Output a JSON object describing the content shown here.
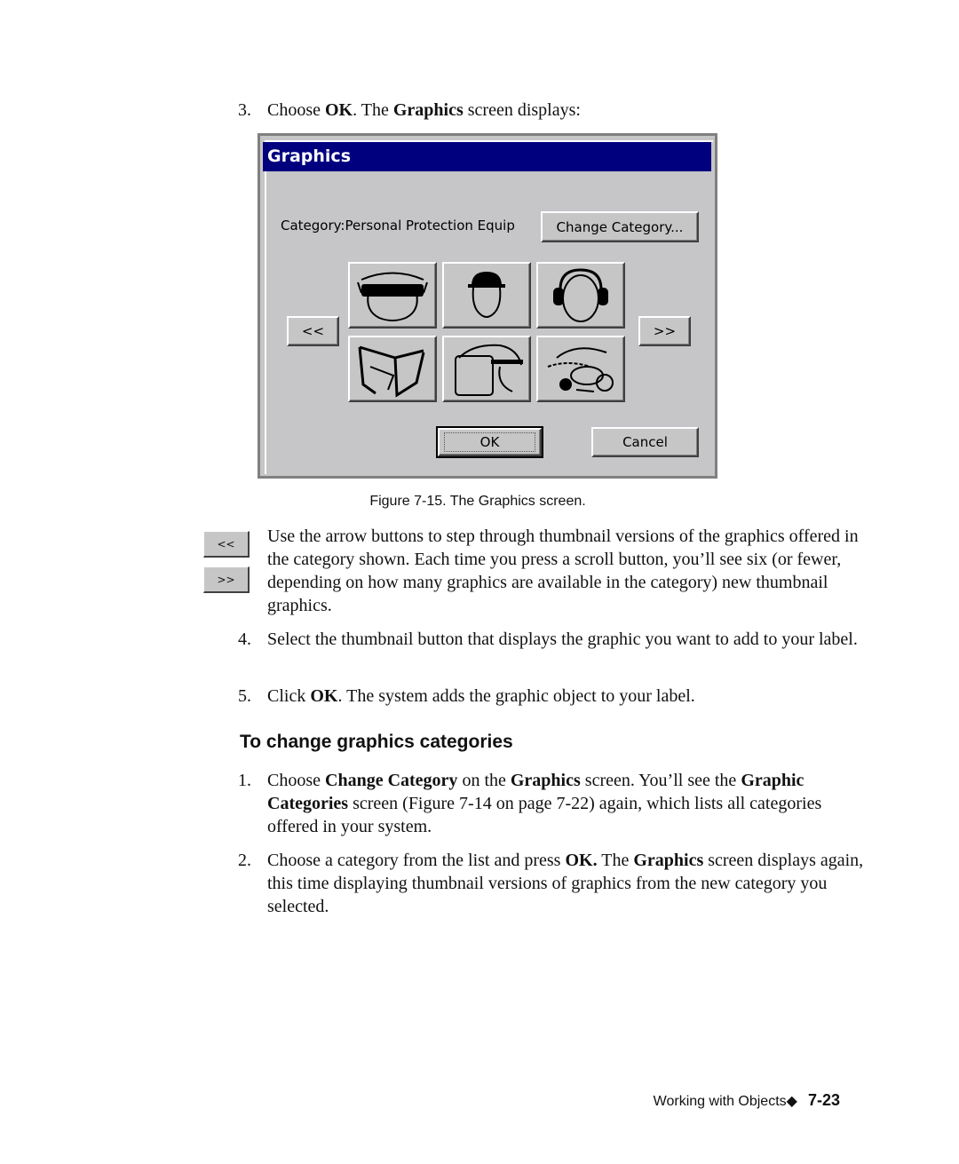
{
  "step3": {
    "num": "3.",
    "pre": "Choose ",
    "b1": "OK",
    "mid": ". The ",
    "b2": "Graphics",
    "post": " screen displays:"
  },
  "dialog": {
    "title": "Graphics",
    "category_label": "Category:",
    "category_value": "Personal Protection Equip",
    "change_category_button": "Change Category...",
    "prev_button": "<<",
    "next_button": ">>",
    "thumbnails": [
      {
        "icon": "goggles-face-icon"
      },
      {
        "icon": "hard-hat-face-icon"
      },
      {
        "icon": "ear-muffs-icon"
      },
      {
        "icon": "safety-glasses-icon"
      },
      {
        "icon": "face-shield-icon"
      },
      {
        "icon": "respirator-mask-icon"
      }
    ],
    "ok_button": "OK",
    "cancel_button": "Cancel",
    "colors": {
      "titlebar": "#00007f",
      "face": "#c6c6c6"
    }
  },
  "caption": "Figure 7-15. The Graphics screen.",
  "side_buttons": {
    "prev": "<<",
    "next": ">>"
  },
  "para": "Use the arrow buttons to step through thumbnail versions of the graphics offered in the category shown. Each time you press a scroll button, you’ll see six (or fewer, depending on how many graphics are available in the category) new thumbnail graphics.",
  "step4": {
    "num": "4.",
    "text": "Select the thumbnail button that displays the graphic you want to add to your label."
  },
  "step5": {
    "num": "5.",
    "pre": "Click ",
    "b1": "OK",
    "post": ". The system adds the graphic object to your label."
  },
  "heading": "To change graphics categories",
  "cat_step1": {
    "num": "1.",
    "pre": "Choose ",
    "b1": "Change Category",
    "mid1": " on the ",
    "b2": "Graphics",
    "mid2": " screen. You’ll see the ",
    "b3": "Graphic Categories",
    "post": " screen (Figure 7-14 on page 7-22) again, which lists all categories offered in your system."
  },
  "cat_step2": {
    "num": "2.",
    "pre": "Choose a category from the list and press ",
    "b1": "OK.",
    "mid": " The ",
    "b2": "Graphics",
    "post": " screen displays again, this time displaying thumbnail versions of graphics from the new category you selected."
  },
  "footer": {
    "section": "Working with Objects",
    "diamond": "◆",
    "page": "7-23"
  }
}
